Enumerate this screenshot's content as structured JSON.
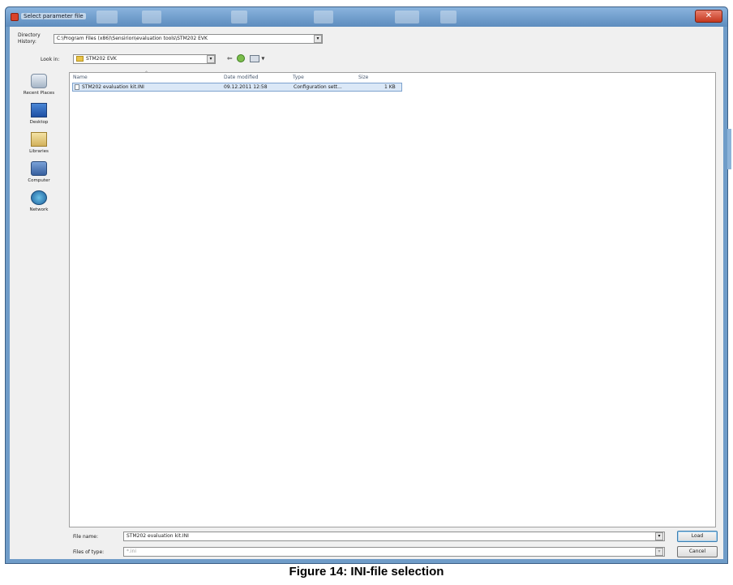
{
  "window": {
    "title": "Select parameter file",
    "close_glyph": "✕"
  },
  "top": {
    "directory_history_label_1": "Directory",
    "directory_history_label_2": "History:",
    "directory_history_value": "C:\\Program Files (x86)\\Sensirion\\evaluation tools\\STM202 EVK",
    "look_in_label": "Look in:",
    "look_in_value": "STM202 EVK",
    "dropdown_glyph": "▾"
  },
  "toolbar": {
    "back_glyph": "⇐",
    "up_icon": "folder-up-icon",
    "view_menu_glyph": "▾"
  },
  "places": [
    {
      "label": "Recent Places",
      "icon": "recent-places-icon"
    },
    {
      "label": "Desktop",
      "icon": "desktop-icon"
    },
    {
      "label": "Libraries",
      "icon": "libraries-icon"
    },
    {
      "label": "Computer",
      "icon": "computer-icon"
    },
    {
      "label": "Network",
      "icon": "network-icon"
    }
  ],
  "file_list": {
    "columns": [
      "Name",
      "Date modified",
      "Type",
      "Size"
    ],
    "sort_glyph": "⌃",
    "rows": [
      {
        "name": "STM202 evaluation kit.INI",
        "date": "09.12.2011 12:58",
        "type": "Configuration sett...",
        "size": "1 KB"
      }
    ]
  },
  "bottom": {
    "file_name_label": "File name:",
    "file_name_value": "STM202 evaluation kit.INI",
    "files_of_type_label": "Files of type:",
    "files_of_type_value": "*.ini",
    "load_button": "Load",
    "cancel_button": "Cancel"
  },
  "caption": "Figure 14: INI-file selection"
}
